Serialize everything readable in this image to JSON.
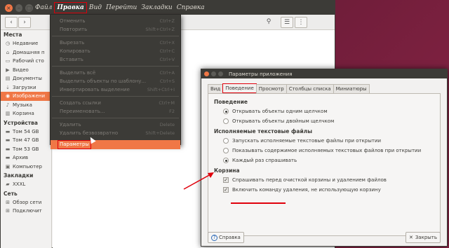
{
  "menubar": [
    "Файл",
    "Правка",
    "Вид",
    "Перейти",
    "Закладки",
    "Справка"
  ],
  "menubar_active_index": 1,
  "sidebar": {
    "groups": [
      {
        "title": "Места",
        "items": [
          {
            "label": "Недавние",
            "icon": "clock-icon"
          },
          {
            "label": "Домашняя п",
            "icon": "home-icon"
          },
          {
            "label": "Рабочий сто",
            "icon": "desktop-icon"
          },
          {
            "label": "Видео",
            "icon": "video-icon"
          },
          {
            "label": "Документы",
            "icon": "document-icon"
          },
          {
            "label": "Загрузки",
            "icon": "download-icon"
          },
          {
            "label": "Изображени",
            "icon": "camera-icon",
            "selected": true
          },
          {
            "label": "Музыка",
            "icon": "music-icon"
          },
          {
            "label": "Корзина",
            "icon": "trash-icon"
          }
        ]
      },
      {
        "title": "Устройства",
        "items": [
          {
            "label": "Том 54 GB",
            "icon": "drive-icon"
          },
          {
            "label": "Том 47 GB",
            "icon": "drive-icon"
          },
          {
            "label": "Том 53 GB",
            "icon": "drive-icon"
          },
          {
            "label": "Архив",
            "icon": "drive-icon"
          },
          {
            "label": "Компьютер",
            "icon": "computer-icon"
          }
        ]
      },
      {
        "title": "Закладки",
        "items": [
          {
            "label": "XXXL",
            "icon": "folder-icon"
          }
        ]
      },
      {
        "title": "Сеть",
        "items": [
          {
            "label": "Обзор сети",
            "icon": "network-icon"
          },
          {
            "label": "Подключит",
            "icon": "network-icon"
          }
        ]
      }
    ]
  },
  "edit_menu": {
    "groups": [
      [
        {
          "label": "Отменить",
          "shortcut": "Ctrl+Z"
        },
        {
          "label": "Повторить",
          "shortcut": "Shift+Ctrl+Z"
        }
      ],
      [
        {
          "label": "Вырезать",
          "shortcut": "Ctrl+X"
        },
        {
          "label": "Копировать",
          "shortcut": "Ctrl+C"
        },
        {
          "label": "Вставить",
          "shortcut": "Ctrl+V"
        }
      ],
      [
        {
          "label": "Выделить всё",
          "shortcut": "Ctrl+A"
        },
        {
          "label": "Выделить объекты по шаблону...",
          "shortcut": "Ctrl+S"
        },
        {
          "label": "Инвертировать выделение",
          "shortcut": "Shift+Ctrl+I"
        }
      ],
      [
        {
          "label": "Создать ссылки",
          "shortcut": "Ctrl+M"
        },
        {
          "label": "Переименовать...",
          "shortcut": "F2"
        }
      ],
      [
        {
          "label": "Удалить",
          "shortcut": "Delete"
        },
        {
          "label": "Удалить безвозвратно",
          "shortcut": "Shift+Delete"
        }
      ]
    ],
    "highlighted": "Параметры"
  },
  "dialog": {
    "title": "Параметры приложения",
    "tabs": [
      "Вид",
      "Поведение",
      "Просмотр",
      "Столбцы списка",
      "Миниатюры"
    ],
    "active_tab_index": 1,
    "sections": [
      {
        "heading": "Поведение",
        "kind": "radio",
        "options": [
          {
            "label": "Открывать объекты одним щелчком",
            "checked": true
          },
          {
            "label": "Открывать объекты двойным щелчком",
            "checked": false
          }
        ]
      },
      {
        "heading": "Исполняемые текстовые файлы",
        "kind": "radio",
        "options": [
          {
            "label": "Запускать исполняемые текстовые файлы при открытии",
            "checked": false
          },
          {
            "label": "Показывать содержимое исполняемых текстовых файлов при открытии",
            "checked": false
          },
          {
            "label": "Каждый раз спрашивать",
            "checked": true
          }
        ]
      },
      {
        "heading": "Корзина",
        "kind": "checkbox",
        "options": [
          {
            "label": "Спрашивать перед очисткой корзины и удалением файлов",
            "checked": true
          },
          {
            "label": "Включить команду удаления, не использующую корзину",
            "checked": true
          }
        ]
      }
    ],
    "help_label": "Справка",
    "close_label": "Закрыть"
  },
  "colors": {
    "accent": "#f07746",
    "annotation": "#e0000b"
  }
}
